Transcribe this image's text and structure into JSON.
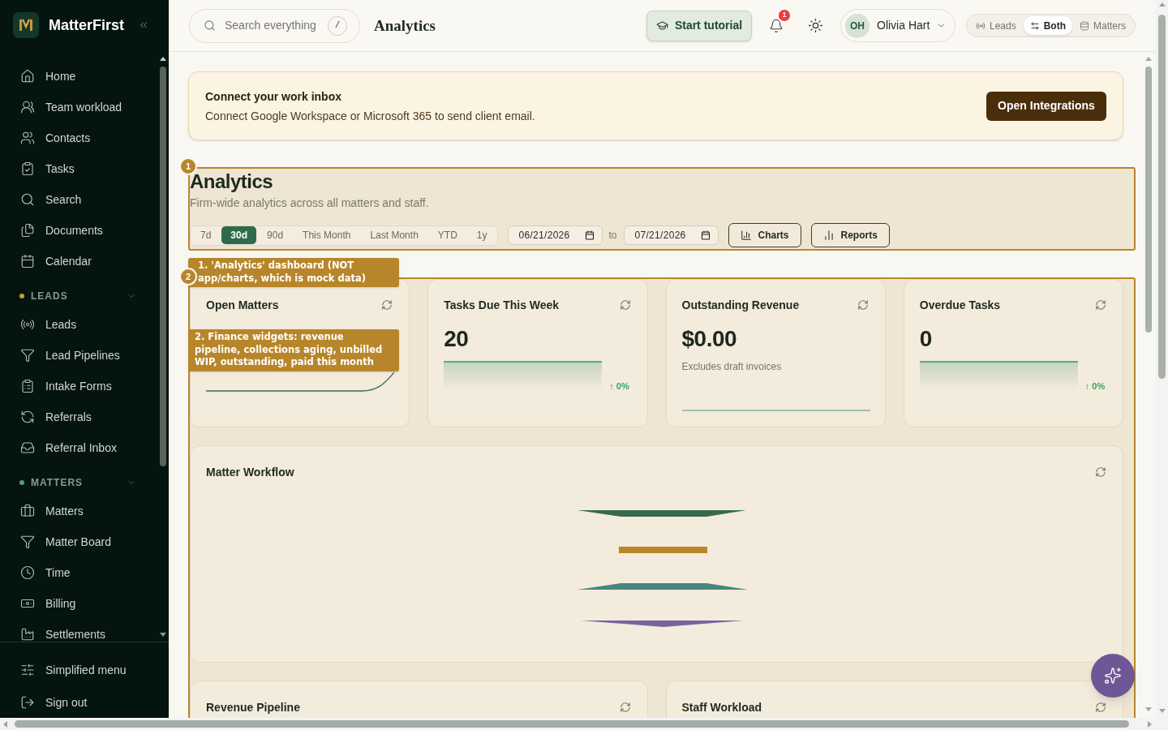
{
  "sidebar": {
    "brand": "MatterFirst",
    "items": [
      {
        "label": "Home",
        "selected": false
      },
      {
        "label": "Team workload",
        "selected": false
      },
      {
        "label": "Contacts",
        "selected": false
      },
      {
        "label": "Tasks",
        "selected": false
      },
      {
        "label": "Search",
        "selected": false
      },
      {
        "label": "Documents",
        "selected": false
      },
      {
        "label": "Calendar",
        "selected": false
      }
    ],
    "sections": [
      {
        "title": "LEADS",
        "color": "#c99a3c",
        "expanded": true,
        "items": [
          {
            "label": "Leads",
            "selected": false
          },
          {
            "label": "Lead Pipelines",
            "selected": false
          },
          {
            "label": "Intake Forms",
            "selected": false
          },
          {
            "label": "Referrals",
            "selected": false
          },
          {
            "label": "Referral Inbox",
            "selected": false
          }
        ]
      },
      {
        "title": "MATTERS",
        "color": "#5e9b7b",
        "expanded": true,
        "items": [
          {
            "label": "Matters",
            "selected": false
          },
          {
            "label": "Matter Board",
            "selected": false
          },
          {
            "label": "Time",
            "selected": false
          },
          {
            "label": "Billing",
            "selected": false
          },
          {
            "label": "Settlements",
            "selected": false
          }
        ]
      }
    ],
    "footer": [
      {
        "label": "Simplified menu"
      },
      {
        "label": "Sign out"
      }
    ]
  },
  "top_bar": {
    "search": {
      "placeholder": "Search everything",
      "shortcut": "/"
    },
    "title": "Analytics",
    "tutorial_button": "Start tutorial",
    "notifications": {
      "count": "1"
    },
    "user": {
      "initials": "OH",
      "name": "Olivia Hart"
    },
    "view_toggle": [
      {
        "label": "Leads",
        "selected": false
      },
      {
        "label": "Both",
        "selected": true
      },
      {
        "label": "Matters",
        "selected": false
      }
    ]
  },
  "banner": {
    "title": "Connect your work inbox",
    "text": "Connect Google Workspace or Microsoft 365 to send client email.",
    "button": "Open Integrations"
  },
  "tutorial": [
    {
      "number": "1",
      "note": "1. 'Analytics' dashboard (NOT app/charts, which is mock data)"
    },
    {
      "number": "2",
      "note": "2. Finance widgets: revenue pipeline, collections aging, unbilled WIP, outstanding, paid this month"
    }
  ],
  "header": {
    "title": "Analytics",
    "subtitle": "Firm-wide analytics across all matters and staff.",
    "ranges": [
      {
        "label": "7d",
        "selected": false
      },
      {
        "label": "30d",
        "selected": true
      },
      {
        "label": "90d",
        "selected": false
      },
      {
        "label": "This Month",
        "selected": false
      },
      {
        "label": "Last Month",
        "selected": false
      },
      {
        "label": "YTD",
        "selected": false
      },
      {
        "label": "1y",
        "selected": false
      }
    ],
    "date_from": "06/21/2026",
    "date_separator": "to",
    "date_to": "07/21/2026",
    "buttons": [
      "Charts",
      "Reports"
    ]
  },
  "widgets": [
    {
      "kind": "line",
      "title": "Open Matters"
    },
    {
      "kind": "area",
      "title": "Tasks Due This Week",
      "value": "20",
      "change": "↑ 0%"
    },
    {
      "kind": "note",
      "title": "Outstanding Revenue",
      "value": "$0.00",
      "note": "Excludes draft invoices"
    },
    {
      "kind": "area",
      "title": "Overdue Tasks",
      "value": "0",
      "change": "↑ 0%"
    }
  ],
  "workflow": {
    "title": "Matter Workflow"
  },
  "bottom_panels": [
    {
      "title": "Revenue Pipeline"
    },
    {
      "title": "Staff Workload"
    }
  ]
}
